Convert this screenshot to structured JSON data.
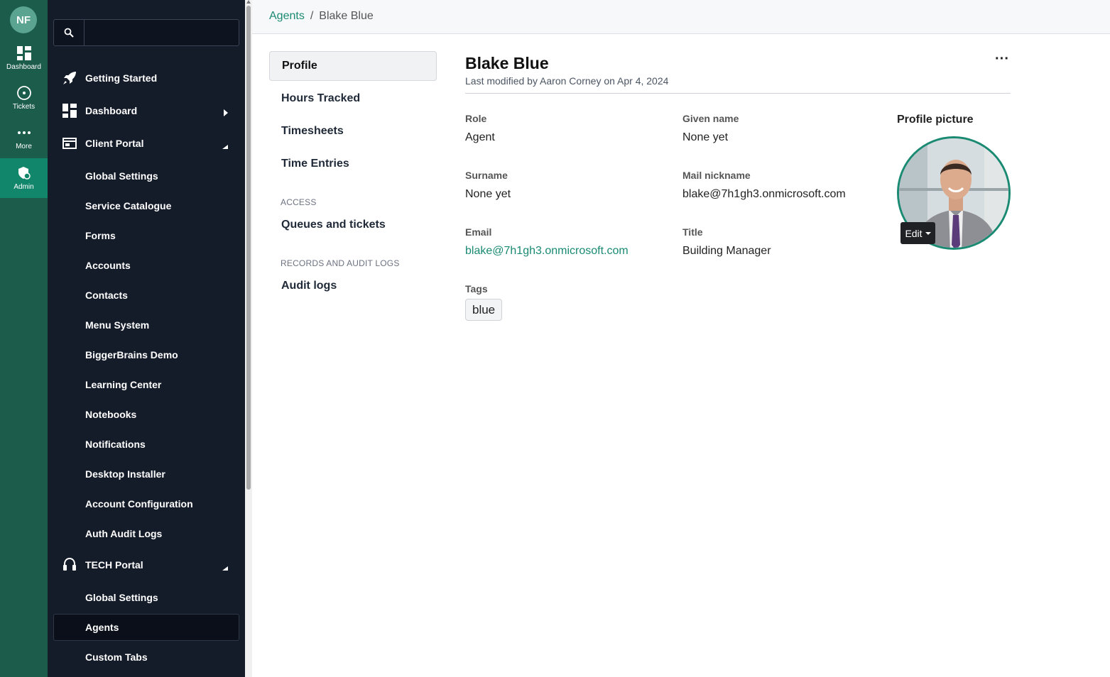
{
  "rail": {
    "avatar_initials": "NF",
    "items": [
      {
        "label": "Dashboard",
        "icon": "dashboard-grid-icon"
      },
      {
        "label": "Tickets",
        "icon": "ticket-circle-icon"
      },
      {
        "label": "More",
        "icon": "more-dots-icon"
      },
      {
        "label": "Admin",
        "icon": "admin-shield-icon",
        "active": true
      }
    ]
  },
  "nav": {
    "search_value": "",
    "items": [
      {
        "label": "Getting Started",
        "icon": "rocket-icon"
      },
      {
        "label": "Dashboard",
        "icon": "dashboard-icon",
        "chevron": "right"
      },
      {
        "label": "Client Portal",
        "icon": "browser-window-icon",
        "chevron": "up"
      },
      {
        "label": "Global Settings"
      },
      {
        "label": "Service Catalogue"
      },
      {
        "label": "Forms"
      },
      {
        "label": "Accounts"
      },
      {
        "label": "Contacts"
      },
      {
        "label": "Menu System"
      },
      {
        "label": "BiggerBrains Demo"
      },
      {
        "label": "Learning Center"
      },
      {
        "label": "Notebooks"
      },
      {
        "label": "Notifications"
      },
      {
        "label": "Desktop Installer"
      },
      {
        "label": "Account Configuration"
      },
      {
        "label": "Auth Audit Logs"
      },
      {
        "label": "TECH Portal",
        "icon": "headset-icon",
        "chevron": "up"
      },
      {
        "label": "Global Settings"
      },
      {
        "label": "Agents",
        "active": true
      },
      {
        "label": "Custom Tabs"
      }
    ]
  },
  "breadcrumb": {
    "parent": "Agents",
    "separator": "/",
    "current": "Blake Blue"
  },
  "submenu": {
    "items": [
      "Profile",
      "Hours Tracked",
      "Timesheets",
      "Time Entries"
    ],
    "access_label": "ACCESS",
    "access_items": [
      "Queues and tickets"
    ],
    "records_label": "RECORDS AND AUDIT LOGS",
    "records_items": [
      "Audit logs"
    ]
  },
  "profile": {
    "name": "Blake Blue",
    "modified": "Last modified by Aaron Corney on Apr 4, 2024",
    "more_glyph": "···",
    "fields": {
      "role_label": "Role",
      "role": "Agent",
      "given_name_label": "Given name",
      "given_name": "None yet",
      "surname_label": "Surname",
      "surname": "None yet",
      "mail_nickname_label": "Mail nickname",
      "mail_nickname": "blake@7h1gh3.onmicrosoft.com",
      "email_label": "Email",
      "email": "blake@7h1gh3.onmicrosoft.com",
      "title_label": "Title",
      "title": "Building Manager",
      "tags_label": "Tags",
      "tags": [
        "blue"
      ]
    },
    "picture_label": "Profile picture",
    "edit_label": "Edit"
  },
  "colors": {
    "rail_bg": "#1c5c4b",
    "nav_bg": "#141b29",
    "accent": "#1a8a72"
  }
}
